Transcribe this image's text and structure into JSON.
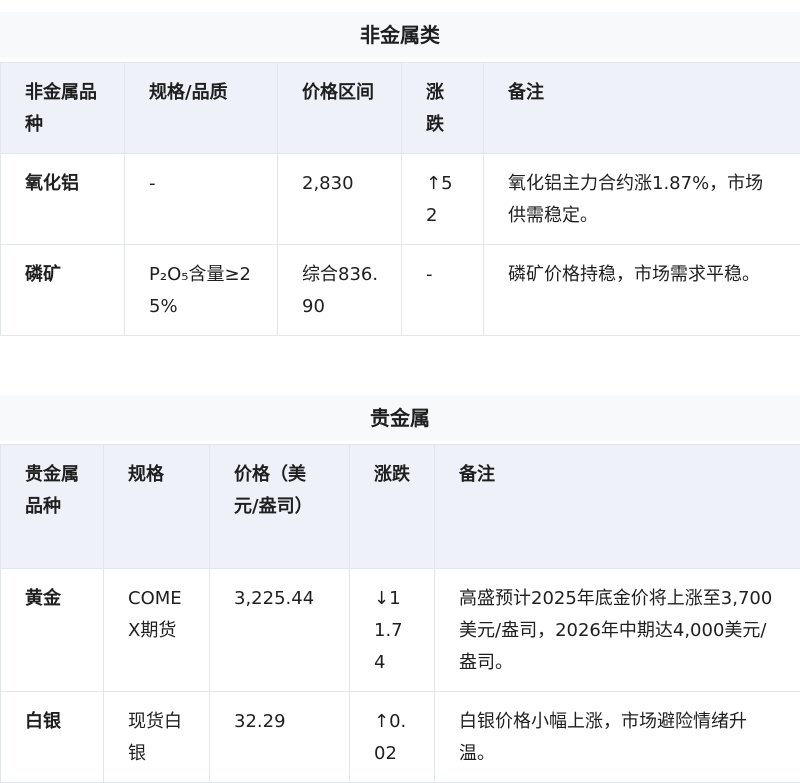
{
  "section1": {
    "title": "非金属类",
    "headers": [
      "非金属品种",
      "规格/品质",
      "价格区间",
      "涨跌",
      "备注"
    ],
    "rows": [
      {
        "name": "氧化铝",
        "spec": "-",
        "price": "2,830",
        "change": "↑52",
        "note": "氧化铝主力合约涨1.87%，市场供需稳定。"
      },
      {
        "name": "磷矿",
        "spec": "P₂O₅含量≥25%",
        "price": "综合836.90",
        "change": "-",
        "note": "磷矿价格持稳，市场需求平稳。"
      }
    ]
  },
  "section2": {
    "title": "贵金属",
    "headers": [
      "贵金属品种",
      "规格",
      "价格（美元/盎司）",
      "涨跌",
      "备注"
    ],
    "rows": [
      {
        "name": "黄金",
        "spec": "COMEX期货",
        "price": "3,225.44",
        "change": "↓11.74",
        "note": "高盛预计2025年底金价将上涨至3,700美元/盎司，2026年中期达4,000美元/盎司。"
      },
      {
        "name": "白银",
        "spec": "现货白银",
        "price": "32.29",
        "change": "↑0.02",
        "note": "白银价格小幅上涨，市场避险情绪升温。"
      }
    ]
  }
}
